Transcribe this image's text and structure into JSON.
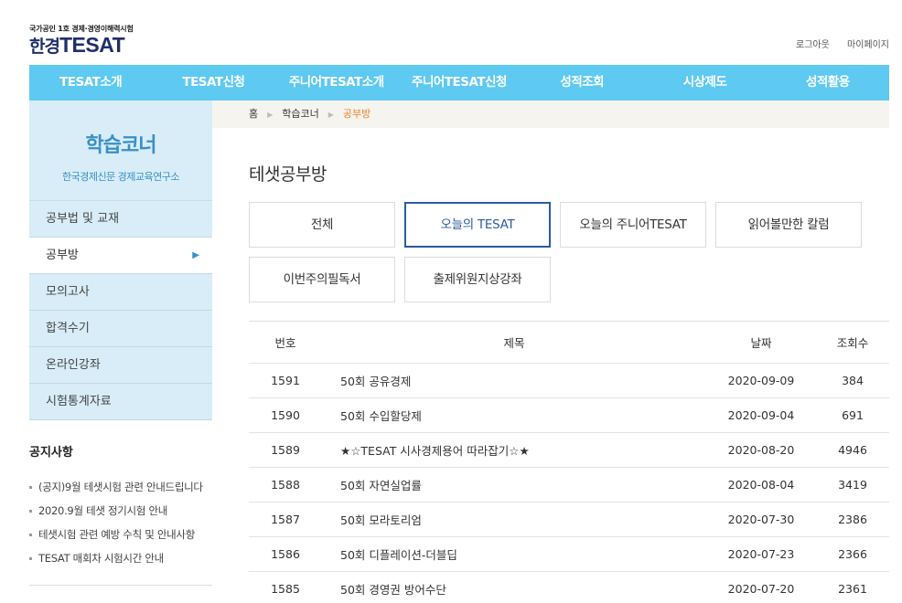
{
  "header": {
    "tagline": "국가공인 1호 경제·경영이해력시험",
    "logo_ko": "한경",
    "logo_en": "TESAT",
    "logout": "로그아웃",
    "mypage": "마이페이지"
  },
  "gnb": [
    "TESAT소개",
    "TESAT신청",
    "주니어TESAT소개",
    "주니어TESAT신청",
    "성적조회",
    "시상제도",
    "성적활용"
  ],
  "sidebar": {
    "title": "학습코너",
    "subtitle": "한국경제신문 경제교육연구소",
    "items": [
      {
        "label": "공부법 및 교재"
      },
      {
        "label": "공부방",
        "arrow": "▶"
      },
      {
        "label": "모의고사"
      },
      {
        "label": "합격수기"
      },
      {
        "label": "온라인강좌"
      },
      {
        "label": "시험통계자료"
      }
    ]
  },
  "notice": {
    "title": "공지사항",
    "items": [
      "(공지)9월 테샛시험 관련 안내드립니다",
      "2020.9월 테샛 정기시험 안내",
      "테샛시험 관련 예방 수칙 및 안내사항",
      "TESAT 매회차 시험시간 안내"
    ]
  },
  "breadcrumb": {
    "home": "홈",
    "sep": "▶",
    "level1": "학습코너",
    "current": "공부방"
  },
  "page_title": "테샛공부방",
  "categories": [
    "전체",
    "오늘의 TESAT",
    "오늘의 주니어TESAT",
    "읽어볼만한 칼럼",
    "이번주의필독서",
    "출제위원지상강좌"
  ],
  "board": {
    "headers": {
      "no": "번호",
      "title": "제목",
      "date": "날짜",
      "views": "조회수"
    },
    "rows": [
      {
        "no": "1591",
        "title": "50회 공유경제",
        "date": "2020-09-09",
        "views": "384"
      },
      {
        "no": "1590",
        "title": "50회 수입할당제",
        "date": "2020-09-04",
        "views": "691"
      },
      {
        "no": "1589",
        "title": "★☆TESAT 시사경제용어 따라잡기☆★",
        "date": "2020-08-20",
        "views": "4946"
      },
      {
        "no": "1588",
        "title": "50회 자연실업률",
        "date": "2020-08-04",
        "views": "3419"
      },
      {
        "no": "1587",
        "title": "50회 모라토리엄",
        "date": "2020-07-30",
        "views": "2386"
      },
      {
        "no": "1586",
        "title": "50회 디플레이션-더블딥",
        "date": "2020-07-23",
        "views": "2366"
      },
      {
        "no": "1585",
        "title": "50회 경영권 방어수단",
        "date": "2020-07-20",
        "views": "2361"
      }
    ]
  }
}
